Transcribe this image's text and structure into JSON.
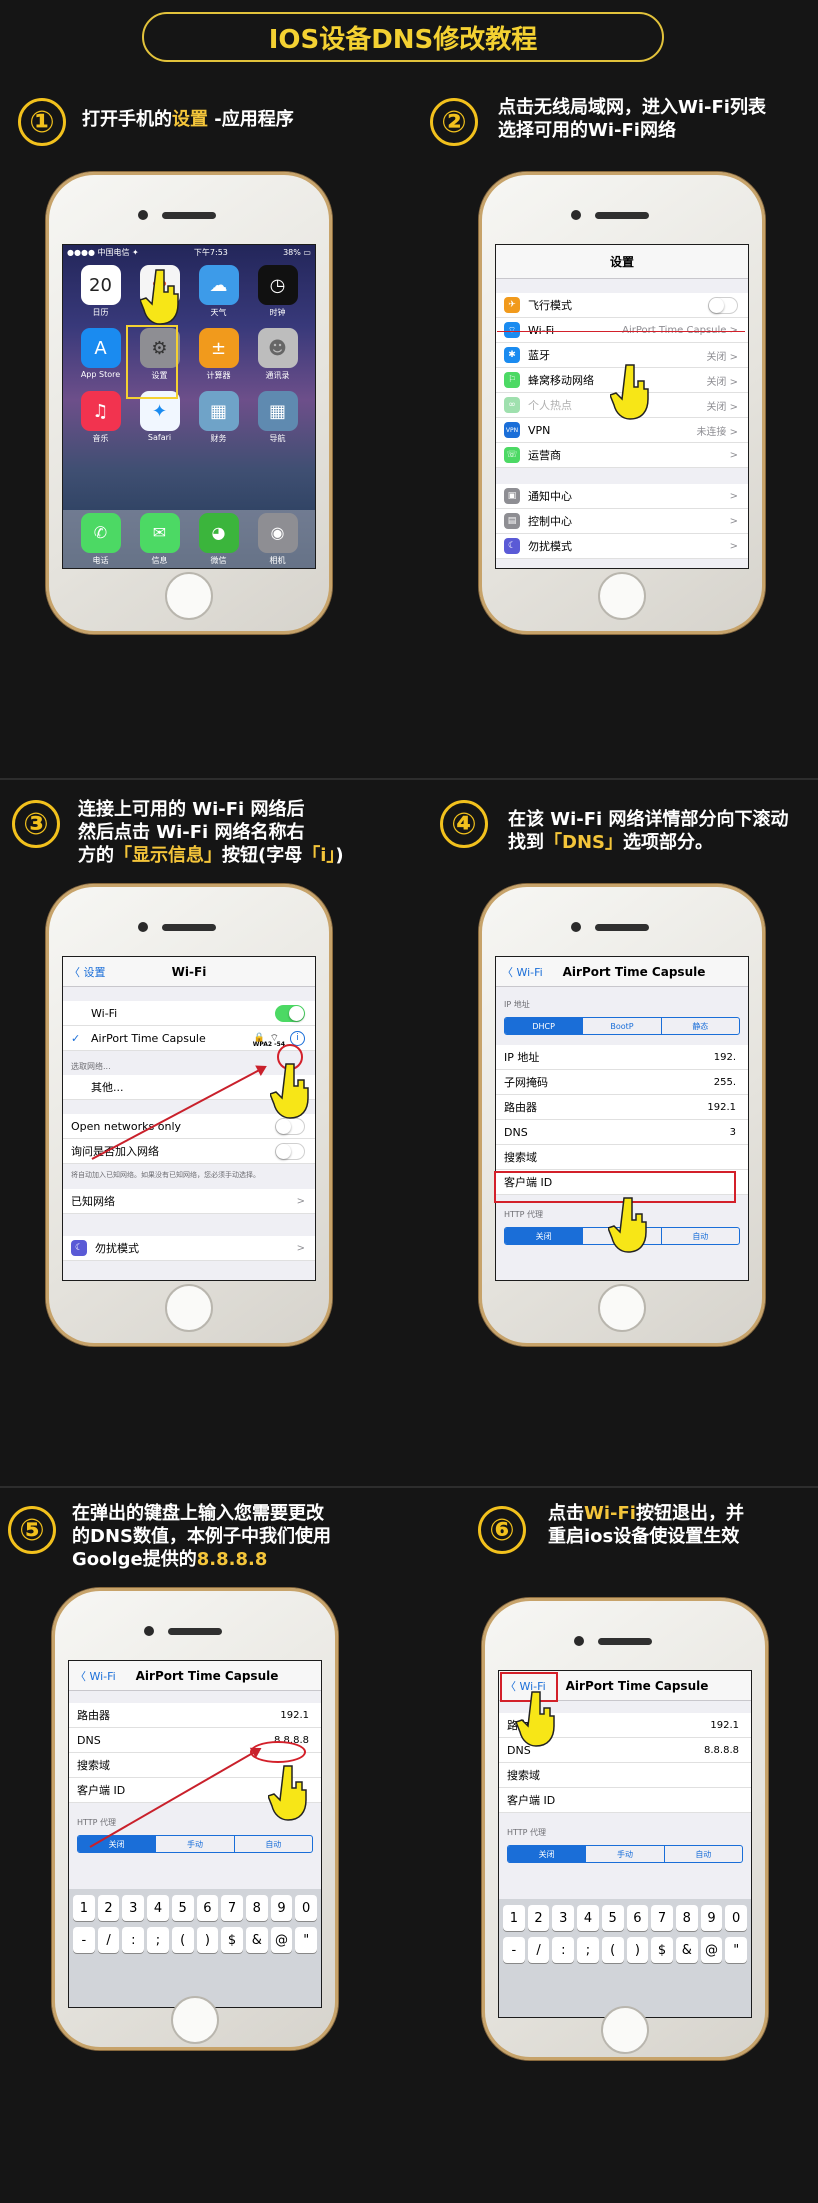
{
  "title": "IOS设备DNS修改教程",
  "steps": [
    {
      "num": "①",
      "t1": "打开手机的",
      "t1hl": "设置",
      "t1b": " -应用程序"
    },
    {
      "num": "②",
      "l1": "点击无线局域网，进入Wi-Fi列表",
      "l2": "选择可用的Wi-Fi网络"
    },
    {
      "num": "③",
      "l1": "连接上可用的 Wi-Fi 网络后",
      "l2": "然后点击 Wi-Fi 网络名称右",
      "l3a": "方的",
      "l3hl": "「显示信息」",
      "l3b": "按钮(字母",
      "l3hl2": "「i」",
      "l3c": ")"
    },
    {
      "num": "④",
      "l1": "在该 Wi-Fi 网络详情部分向下滚动",
      "l2a": "找到",
      "l2hl": "「DNS」",
      "l2b": "选项部分。"
    },
    {
      "num": "⑤",
      "l1": "在弹出的键盘上输入您需要更改",
      "l2": "的DNS数值，本例子中我们使用",
      "l3a": "Goolge提供的",
      "l3hl": "8.8.8.8"
    },
    {
      "num": "⑥",
      "l1a": "点击",
      "l1hl": "Wi-Fi",
      "l1b": "按钮退出，并",
      "l2": "重启ios设备使设置生效"
    }
  ],
  "home": {
    "status_left": "●●●● 中国电信 ✦",
    "status_time": "下午7:53",
    "status_right": "38% ▭",
    "apps": [
      {
        "label": "日历",
        "glyph": "20",
        "color": "#ffffff",
        "fg": "#222",
        "sub": "星期四"
      },
      {
        "label": "照片",
        "glyph": "✿",
        "color": "#f5f5f5",
        "fg": "#e5533d"
      },
      {
        "label": "天气",
        "glyph": "☁",
        "color": "#3d9be9",
        "fg": "#fff"
      },
      {
        "label": "时钟",
        "glyph": "◷",
        "color": "#111",
        "fg": "#fff"
      },
      {
        "label": "App Store",
        "glyph": "A",
        "color": "#1a8bf0",
        "fg": "#fff"
      },
      {
        "label": "设置",
        "glyph": "⚙",
        "color": "#8e8e93",
        "fg": "#333"
      },
      {
        "label": "计算器",
        "glyph": "±",
        "color": "#f19a1c",
        "fg": "#fff"
      },
      {
        "label": "通讯录",
        "glyph": "☻",
        "color": "#bdbdbd",
        "fg": "#666"
      },
      {
        "label": "音乐",
        "glyph": "♫",
        "color": "#f2334f",
        "fg": "#fff"
      },
      {
        "label": "Safari",
        "glyph": "✦",
        "color": "#f1f7ff",
        "fg": "#1a8bf0"
      },
      {
        "label": "财务",
        "glyph": "▦",
        "color": "#6fa3c8",
        "fg": "#fff"
      },
      {
        "label": "导航",
        "glyph": "▦",
        "color": "#5f8ab0",
        "fg": "#fff"
      }
    ],
    "dock": [
      {
        "label": "电话",
        "glyph": "✆",
        "color": "#4cd964"
      },
      {
        "label": "信息",
        "glyph": "✉",
        "color": "#4cd964"
      },
      {
        "label": "微信",
        "glyph": "◕",
        "color": "#3bb53c"
      },
      {
        "label": "相机",
        "glyph": "◉",
        "color": "#8e8e93"
      }
    ]
  },
  "settings": {
    "title": "设置",
    "rows": [
      {
        "icon": "airplane-icon",
        "glyph": "✈",
        "color": "#f19a1c",
        "label": "飞行模式",
        "value": "",
        "toggle": true
      },
      {
        "icon": "wifi-icon",
        "glyph": "⌔",
        "color": "#1a8bf0",
        "label": "Wi-Fi",
        "value": "AirPort Time Capsule >"
      },
      {
        "icon": "bluetooth-icon",
        "glyph": "✱",
        "color": "#1a8bf0",
        "label": "蓝牙",
        "value": "关闭 >"
      },
      {
        "icon": "cellular-icon",
        "glyph": "⚐",
        "color": "#4cd964",
        "label": "蜂窝移动网络",
        "value": "关闭 >"
      },
      {
        "icon": "hotspot-icon",
        "glyph": "∞",
        "color": "#9fe0ae",
        "label": "个人热点",
        "value": "关闭 >",
        "dim": true
      },
      {
        "icon": "vpn-icon",
        "glyph": "VPN",
        "color": "#1a6ed8",
        "label": "VPN",
        "value": "未连接 >"
      },
      {
        "icon": "carrier-icon",
        "glyph": "☏",
        "color": "#4cd964",
        "label": "运营商",
        "value": ">"
      }
    ],
    "rows2": [
      {
        "icon": "notification-icon",
        "glyph": "▣",
        "color": "#8e8e93",
        "label": "通知中心",
        "value": ">"
      },
      {
        "icon": "control-center-icon",
        "glyph": "▤",
        "color": "#8e8e93",
        "label": "控制中心",
        "value": ">"
      },
      {
        "icon": "moon-icon",
        "glyph": "☾",
        "color": "#5a5ad6",
        "label": "勿扰模式",
        "value": ">"
      }
    ]
  },
  "wifi": {
    "back": "〈 设置",
    "title": "Wi-Fi",
    "wifi_label": "Wi-Fi",
    "network": "AirPort Time Capsule",
    "check": "✓",
    "security": "WPA2 -54",
    "choose": "选取网络...",
    "other": "其他...",
    "open_networks": "Open networks only",
    "ask_join": "询问是否加入网络",
    "ask_note": "将自动加入已知网络。如果没有已知网络，您必须手动选择。",
    "known": "已知网络",
    "dnd": "勿扰模式",
    "chevron": ">"
  },
  "detail": {
    "back": "〈 Wi-Fi",
    "title": "AirPort Time Capsule",
    "ip_section": "IP 地址",
    "seg": [
      "DHCP",
      "BootP",
      "静态"
    ],
    "rows": [
      {
        "label": "IP 地址",
        "value": "192."
      },
      {
        "label": "子网掩码",
        "value": "255."
      },
      {
        "label": "路由器",
        "value": "192.1"
      },
      {
        "label": "DNS",
        "value": "3"
      },
      {
        "label": "搜索域",
        "value": ""
      },
      {
        "label": "客户端 ID",
        "value": ""
      }
    ],
    "http_section": "HTTP 代理",
    "http_seg": [
      "关闭",
      "手动",
      "自动"
    ]
  },
  "dns_edit": {
    "back": "〈 Wi-Fi",
    "title": "AirPort Time Capsule",
    "rows": [
      {
        "label": "路由器",
        "value": "192.1"
      },
      {
        "label": "DNS",
        "value": "8.8.8.8"
      },
      {
        "label": "搜索域",
        "value": ""
      },
      {
        "label": "客户端 ID",
        "value": ""
      }
    ],
    "http_section": "HTTP 代理",
    "http_seg": [
      "关闭",
      "手动",
      "自动"
    ],
    "keys_row1": [
      "1",
      "2",
      "3",
      "4",
      "5",
      "6",
      "7",
      "8",
      "9",
      "0"
    ],
    "keys_row2": [
      "-",
      "/",
      ":",
      ";",
      "(",
      ")",
      "$",
      "&",
      "@",
      "\""
    ]
  },
  "colors": {
    "accent": "#f2c11d",
    "ios_blue": "#1a6ed8",
    "red": "#d3202a",
    "bg": "#151515"
  }
}
